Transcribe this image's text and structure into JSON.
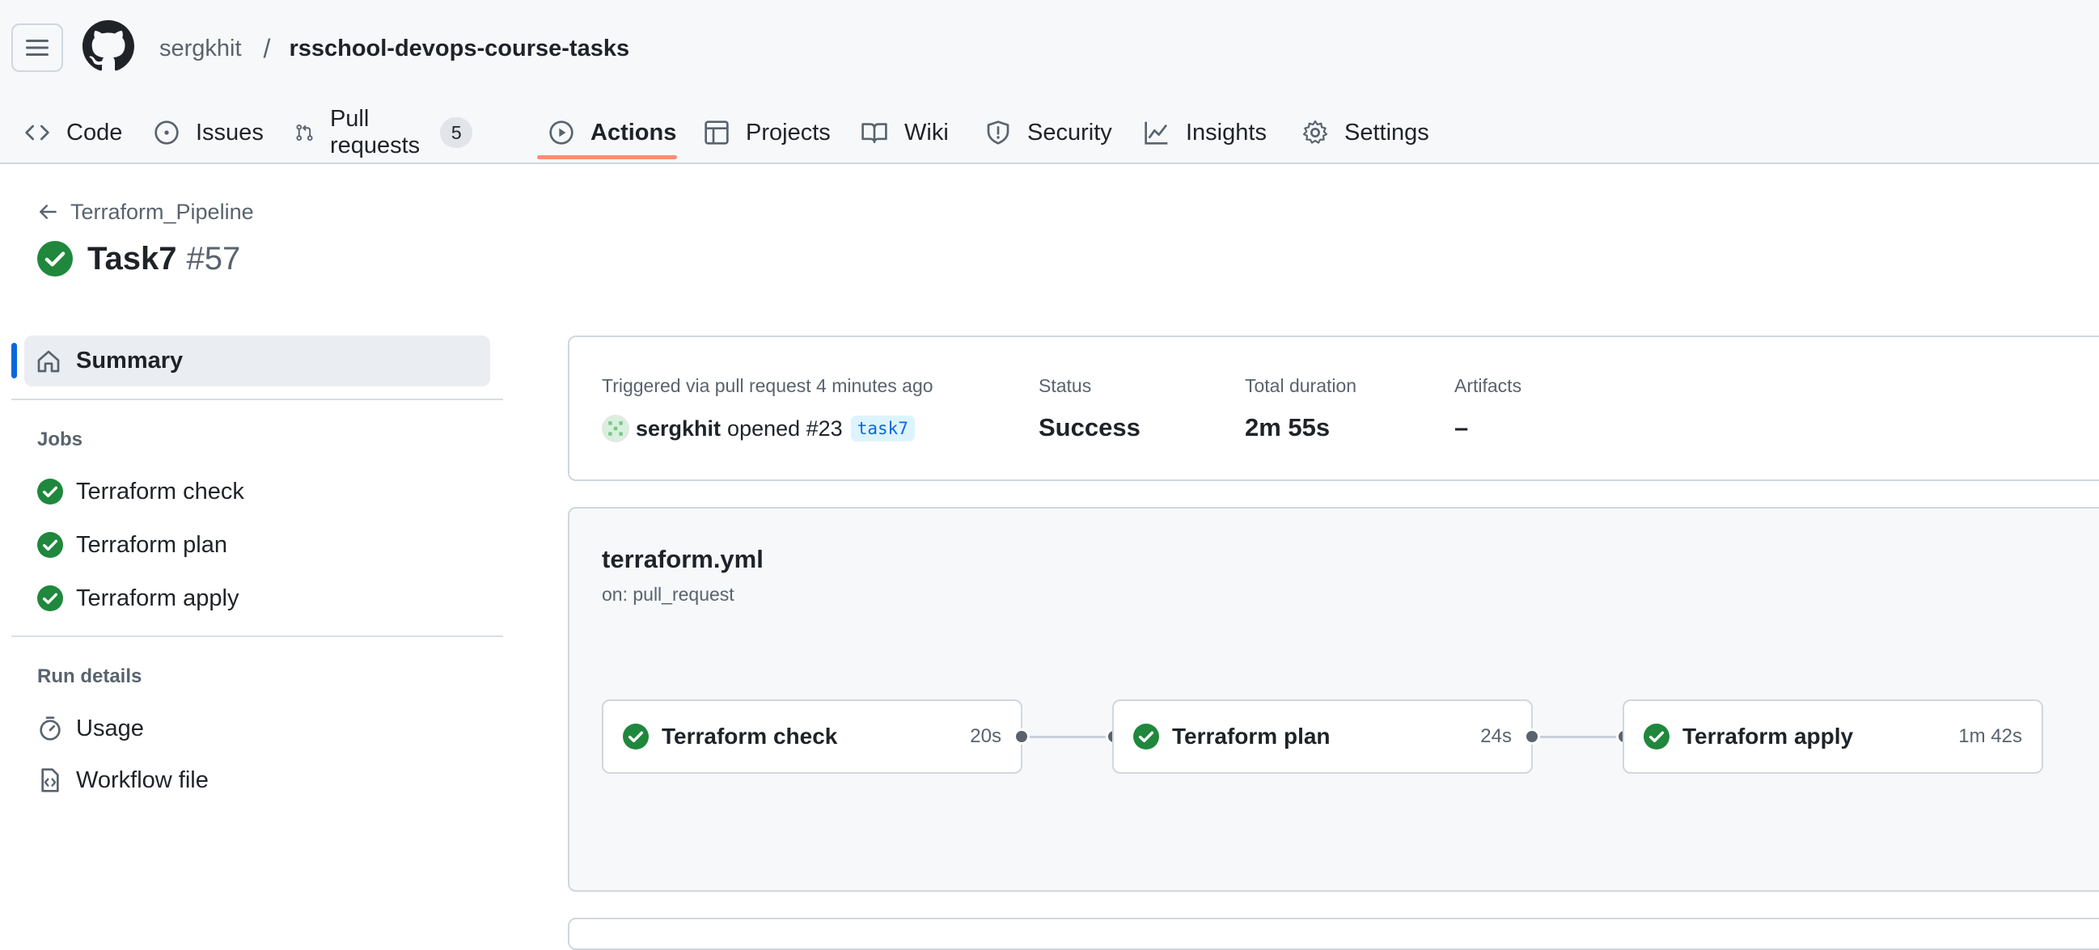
{
  "header": {
    "owner": "sergkhit",
    "separator": "/",
    "repo": "rsschool-devops-course-tasks"
  },
  "tabs": [
    {
      "label": "Code",
      "icon": "code-icon"
    },
    {
      "label": "Issues",
      "icon": "issue-opened-icon"
    },
    {
      "label": "Pull requests",
      "icon": "git-pull-request-icon",
      "count": "5"
    },
    {
      "label": "Actions",
      "icon": "play-icon",
      "active": true
    },
    {
      "label": "Projects",
      "icon": "table-icon"
    },
    {
      "label": "Wiki",
      "icon": "book-icon"
    },
    {
      "label": "Security",
      "icon": "shield-icon"
    },
    {
      "label": "Insights",
      "icon": "graph-icon"
    },
    {
      "label": "Settings",
      "icon": "gear-icon"
    }
  ],
  "run": {
    "workflow": "Terraform_Pipeline",
    "title": "Task7",
    "number": "#57"
  },
  "sidebar": {
    "summary": "Summary",
    "jobs_heading": "Jobs",
    "jobs": [
      "Terraform check",
      "Terraform plan",
      "Terraform apply"
    ],
    "run_details_heading": "Run details",
    "usage": "Usage",
    "workflow_file": "Workflow file"
  },
  "summary": {
    "triggered_label": "Triggered via pull request 4 minutes ago",
    "actor": "sergkhit",
    "action": "opened #23",
    "branch": "task7",
    "status_label": "Status",
    "status_value": "Success",
    "duration_label": "Total duration",
    "duration_value": "2m 55s",
    "artifacts_label": "Artifacts",
    "artifacts_value": "–"
  },
  "graph": {
    "workflow_file": "terraform.yml",
    "trigger": "on: pull_request",
    "jobs": [
      {
        "name": "Terraform check",
        "duration": "20s"
      },
      {
        "name": "Terraform plan",
        "duration": "24s"
      },
      {
        "name": "Terraform apply",
        "duration": "1m 42s"
      }
    ]
  },
  "colors": {
    "success": "#1f883d",
    "accent_underline": "#fd8c73",
    "link_blue": "#0969da"
  }
}
